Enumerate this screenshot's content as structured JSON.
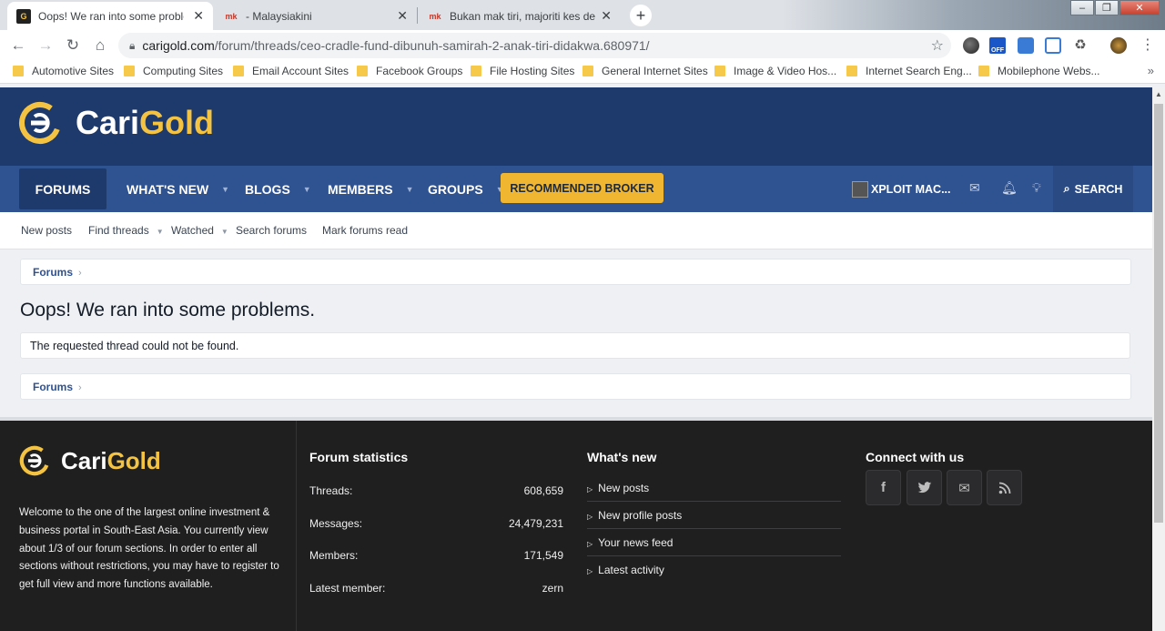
{
  "browser": {
    "tabs": [
      {
        "title": "Oops! We ran into some problem",
        "favicon": "carigold-favicon",
        "active": true
      },
      {
        "title": "- Malaysiakini",
        "favicon": "mk",
        "active": false
      },
      {
        "title": "Bukan mak tiri, majoriti kes dera",
        "favicon": "mk",
        "active": false
      }
    ],
    "close_glyph": "✕",
    "new_tab_glyph": "+",
    "url_host": "carigold.com",
    "url_path": "/forum/threads/ceo-cradle-fund-dibunuh-samirah-2-anak-tiri-didakwa.680971/",
    "ext_badge": "OFF",
    "bookmarks": [
      "Automotive Sites",
      "Computing Sites",
      "Email Account Sites",
      "Facebook Groups",
      "File Hosting Sites",
      "General Internet Sites",
      "Image & Video Hos...",
      "Internet Search Eng...",
      "Mobilephone Webs..."
    ],
    "bookmarks_more": "»"
  },
  "site": {
    "logo_cari": "Cari",
    "logo_gold": "Gold",
    "nav": {
      "forums": "FORUMS",
      "whats_new": "WHAT'S NEW",
      "blogs": "BLOGS",
      "members": "MEMBERS",
      "groups": "GROUPS",
      "broker": "RECOMMENDED BROKER",
      "user": "XPLOIT MAC...",
      "search": "SEARCH"
    },
    "subnav": {
      "new_posts": "New posts",
      "find_threads": "Find threads",
      "watched": "Watched",
      "search_forums": "Search forums",
      "mark_read": "Mark forums read"
    },
    "breadcrumb": "Forums",
    "error_title": "Oops! We ran into some problems.",
    "error_message": "The requested thread could not be found."
  },
  "footer": {
    "about": "Welcome to the one of the largest online investment & business portal in South-East Asia. You currently view about 1/3 of our forum sections. In order to enter all sections without restrictions, you may have to register to get full view and more functions available.",
    "stats_title": "Forum statistics",
    "stats": [
      {
        "label": "Threads:",
        "value": "608,659"
      },
      {
        "label": "Messages:",
        "value": "24,479,231"
      },
      {
        "label": "Members:",
        "value": "171,549"
      },
      {
        "label": "Latest member:",
        "value": "zern"
      }
    ],
    "whats_new_title": "What's new",
    "whats_new": [
      "New posts",
      "New profile posts",
      "Your news feed",
      "Latest activity"
    ],
    "connect_title": "Connect with us",
    "social": [
      "facebook-icon",
      "twitter-icon",
      "mail-icon",
      "rss-icon"
    ]
  },
  "colors": {
    "header": "#1e3a6c",
    "navbar": "#2f5291",
    "gold": "#f5c342",
    "broker": "#f0b632",
    "footer": "#1f1f20"
  }
}
